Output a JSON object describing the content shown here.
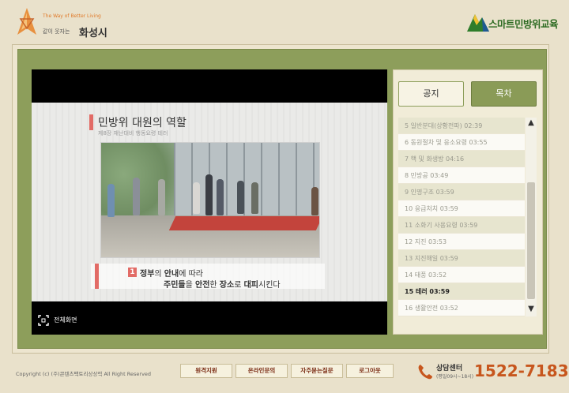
{
  "header": {
    "left_logo_tagline": "The Way of Better Living",
    "left_logo_slogan": "같이 웃자는",
    "left_logo_city": "화성시",
    "right_logo_text": "스마트민방위교육"
  },
  "video": {
    "slide_title": "민방위 대원의 역할",
    "slide_subtitle": "제8장 재난대비 행동요령 테러",
    "caption_number": "1",
    "caption_line1_a": "정부",
    "caption_line1_b": "의 ",
    "caption_line1_c": "안내",
    "caption_line1_d": "에 따라",
    "caption_line2_a": "주민들",
    "caption_line2_b": "을 ",
    "caption_line2_c": "안전",
    "caption_line2_d": "한 ",
    "caption_line2_e": "장소",
    "caption_line2_f": "로 ",
    "caption_line2_g": "대피",
    "caption_line2_h": "시킨다",
    "fullscreen_label": "전체화면"
  },
  "panel": {
    "tabs": [
      {
        "label": "공지"
      },
      {
        "label": "목차"
      }
    ],
    "toc": [
      {
        "label": "5  일반분대(상황전파) 02:39"
      },
      {
        "label": "6  동원절차 및 응소요령 03:55"
      },
      {
        "label": "7  핵 및 화생방 04:16"
      },
      {
        "label": "8  민방공 03:49"
      },
      {
        "label": "9  인명구조 03:59"
      },
      {
        "label": "10  응급처치 03:59"
      },
      {
        "label": "11  소화기 사용요령 03:59"
      },
      {
        "label": "12  지진 03:53"
      },
      {
        "label": "13  지진해일 03:59"
      },
      {
        "label": "14  태풍 03:52"
      },
      {
        "label": "15  테러 03:59",
        "active": true
      },
      {
        "label": "16  생활안전 03:52"
      }
    ],
    "scroll_up": "▲",
    "scroll_down": "▼"
  },
  "footer": {
    "copyright": "Copyright (c) (주)콘텐츠팩토리상상력 All Right Reserved",
    "buttons": [
      {
        "label": "원격지원"
      },
      {
        "label": "온라인문의"
      },
      {
        "label": "자주묻는질문"
      },
      {
        "label": "로그아웃"
      }
    ],
    "help_label": "상담센터",
    "help_hours": "(평일09시~18시)",
    "help_number": "1522-7183"
  },
  "colors": {
    "accent_green": "#8a9b57",
    "accent_red": "#e26b66",
    "phone_orange": "#c7561d"
  }
}
